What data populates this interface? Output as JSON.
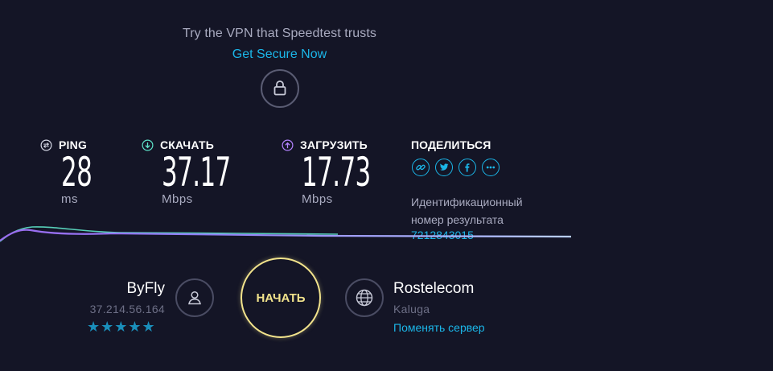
{
  "promo": {
    "text": "Try the VPN that Speedtest trusts",
    "link": "Get Secure Now"
  },
  "metrics": {
    "ping": {
      "label": "PING",
      "value": "28",
      "unit": "ms"
    },
    "download": {
      "label": "СКАЧАТЬ",
      "value": "37.17",
      "unit": "Mbps"
    },
    "upload": {
      "label": "ЗАГРУЗИТЬ",
      "value": "17.73",
      "unit": "Mbps"
    }
  },
  "share": {
    "label": "ПОДЕЛИТЬСЯ",
    "icons": [
      "link-icon",
      "twitter-icon",
      "facebook-icon",
      "more-icon"
    ],
    "result_label": "Идентификационный номер результата",
    "result_id": "7212843015"
  },
  "isp": {
    "name": "ByFly",
    "ip": "37.214.56.164",
    "stars": "★★★★★"
  },
  "start": {
    "label": "НАЧАТЬ"
  },
  "server": {
    "name": "Rostelecom",
    "city": "Kaluga",
    "change_label": "Поменять сервер"
  },
  "colors": {
    "background": "#141526",
    "accent": "#1bb6e8",
    "start": "#f2e38c",
    "download_line": "#5ee3c9",
    "upload_line": "#9b6bf0"
  }
}
